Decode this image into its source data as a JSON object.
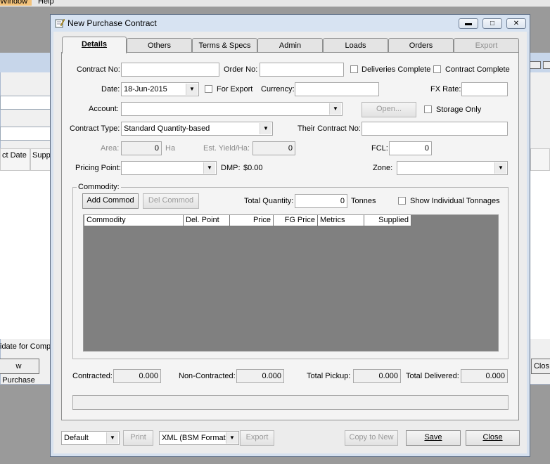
{
  "background_app": {
    "menu": [
      "Window",
      "Help"
    ],
    "column_headers": [
      "ct Date",
      "Supp"
    ],
    "checkbox_label": "idate for Comple",
    "new_button": "w Purchase",
    "close_button": "Clos"
  },
  "dialog": {
    "title": "New Purchase Contract",
    "tabs": [
      {
        "label": "Details",
        "active": true
      },
      {
        "label": "Others"
      },
      {
        "label": "Terms & Specs"
      },
      {
        "label": "Admin"
      },
      {
        "label": "Loads"
      },
      {
        "label": "Orders"
      },
      {
        "label": "Export",
        "disabled": true
      }
    ],
    "details": {
      "contract_no_label": "Contract No:",
      "contract_no": "",
      "order_no_label": "Order No:",
      "order_no": "",
      "deliveries_complete_label": "Deliveries Complete",
      "contract_complete_label": "Contract Complete",
      "date_label": "Date:",
      "date": "18-Jun-2015",
      "for_export_label": "For Export",
      "currency_label": "Currency:",
      "currency": "",
      "fx_rate_label": "FX Rate:",
      "fx_rate": "",
      "account_label": "Account:",
      "account": "",
      "open_button": "Open...",
      "storage_only_label": "Storage Only",
      "contract_type_label": "Contract Type:",
      "contract_type": "Standard Quantity-based",
      "their_contract_no_label": "Their Contract No:",
      "their_contract_no": "",
      "area_label": "Area:",
      "area": "0",
      "area_unit": "Ha",
      "est_yield_label": "Est. Yield/Ha:",
      "est_yield": "0",
      "fcl_label": "FCL:",
      "fcl": "0",
      "pricing_point_label": "Pricing Point:",
      "pricing_point": "",
      "dmp_label": "DMP:",
      "dmp_value": "$0.00",
      "zone_label": "Zone:",
      "zone": ""
    },
    "commodity": {
      "group_label": "Commodity:",
      "add_button": "Add Commod",
      "del_button": "Del Commod",
      "total_quantity_label": "Total Quantity:",
      "total_quantity": "0",
      "total_quantity_unit": "Tonnes",
      "show_individual_label": "Show Individual Tonnages",
      "columns": [
        "Commodity",
        "Del. Point",
        "Price",
        "FG Price",
        "Metrics",
        "Supplied"
      ]
    },
    "totals": {
      "contracted_label": "Contracted:",
      "contracted": "0.000",
      "non_contracted_label": "Non-Contracted:",
      "non_contracted": "0.000",
      "total_pickup_label": "Total Pickup:",
      "total_pickup": "0.000",
      "total_delivered_label": "Total Delivered:",
      "total_delivered": "0.000"
    },
    "footer": {
      "layout_select": "Default",
      "print_button": "Print",
      "format_select": "XML (BSM Format)",
      "export_button": "Export",
      "copy_button": "Copy to New",
      "save_button": "Save",
      "close_button": "Close"
    }
  }
}
